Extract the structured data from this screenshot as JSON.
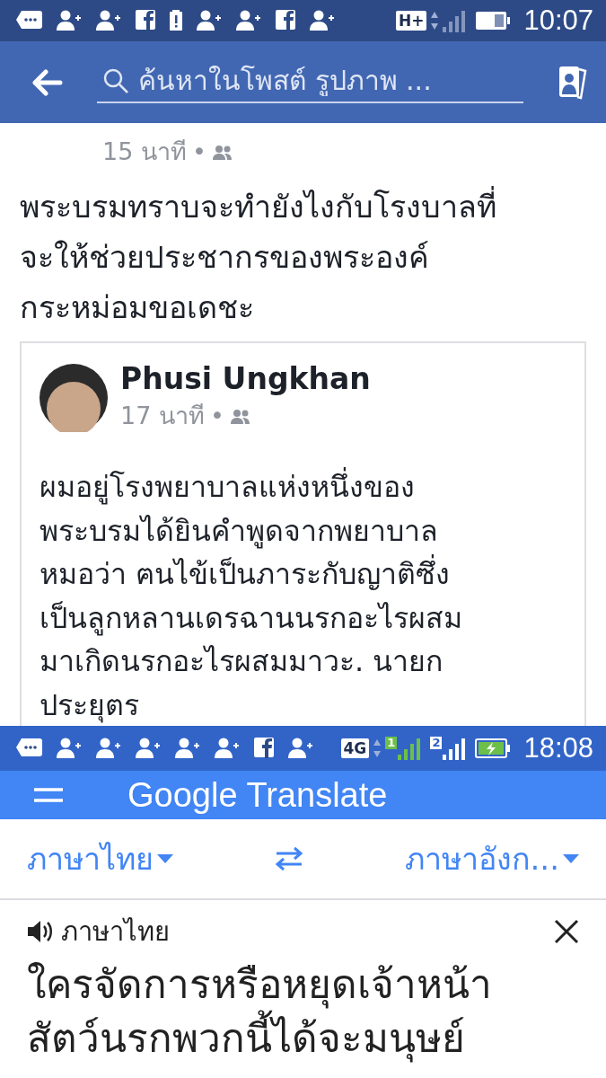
{
  "facebook_screen": {
    "status_bar": {
      "notifications": [
        {
          "kind": "message"
        },
        {
          "kind": "person-add"
        },
        {
          "kind": "person-add"
        },
        {
          "kind": "facebook"
        },
        {
          "kind": "alert"
        },
        {
          "kind": "person-add"
        },
        {
          "kind": "person-add"
        },
        {
          "kind": "facebook"
        },
        {
          "kind": "person-add"
        }
      ],
      "network": "H+",
      "signals": [
        {
          "color": "#8596bd"
        }
      ],
      "battery": {
        "charging": false
      },
      "time": "10:07"
    },
    "search": {
      "placeholder": "ค้นหาในโพสต์ รูปภาพ ..."
    },
    "post": {
      "time": "15 นาที",
      "separator": "•",
      "text": "พระบรมทราบจะทำยังไงกับโรงบาลที่\nจะให้ช่วยประชากรของพระองค์\nกระหม่อมขอเดชะ",
      "shared": {
        "author": "Phusi Ungkhan",
        "time": "17 นาที",
        "separator": "•",
        "text": "ผมอยู่โรงพยาบาลแห่งหนึ่งของ\nพระบรมได้ยินคำพูดจากพยาบาล\nหมอว่า ฅนไข้เป็นภาระกับญาติซึ่ง\nเป็นลูกหลานเดรฉานนรกอะไรผสม\nมาเกิดนรกอะไรผสมมาวะ.  นายก\nประยุตร"
      }
    }
  },
  "translate_screen": {
    "status_bar": {
      "notifications": [
        {
          "kind": "message"
        },
        {
          "kind": "person-add"
        },
        {
          "kind": "person-add"
        },
        {
          "kind": "person-add"
        },
        {
          "kind": "person-add"
        },
        {
          "kind": "person-add"
        },
        {
          "kind": "facebook"
        },
        {
          "kind": "person-add"
        }
      ],
      "network": "4G",
      "signals": [
        {
          "label": "1",
          "color": "#6cc04a"
        },
        {
          "label": "2",
          "color": "#ffffff"
        }
      ],
      "battery": {
        "charging": true
      },
      "time": "18:08"
    },
    "title": "Google Translate",
    "source_language": "ภาษาไทย",
    "target_language": "ภาษาอังก...",
    "input_language": "ภาษาไทย",
    "input_text": "ใครจัดการหรือหยุดเจ้าหน้า\nสัตว์นรกพวกนี้ได้จะมนุษย์"
  }
}
